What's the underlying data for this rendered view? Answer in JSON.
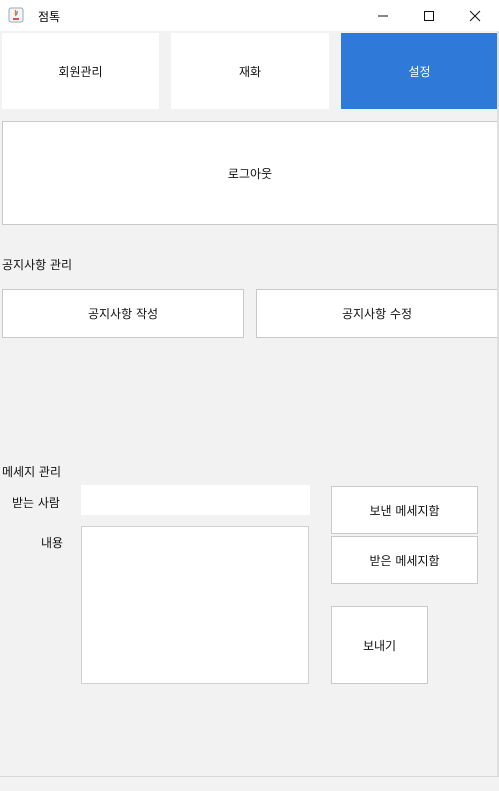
{
  "window": {
    "title": "점톡"
  },
  "tabs": [
    {
      "label": "회원관리",
      "active": false
    },
    {
      "label": "재화",
      "active": false
    },
    {
      "label": "설정",
      "active": true
    }
  ],
  "logout_label": "로그아웃",
  "notice": {
    "section_label": "공지사항 관리",
    "write_label": "공지사항 작성",
    "edit_label": "공지사항 수정"
  },
  "message": {
    "section_label": "메세지 관리",
    "recipient_label": "받는 사람",
    "recipient_value": "",
    "content_label": "내용",
    "content_value": "",
    "sent_box_label": "보낸 메세지함",
    "inbox_label": "받은 메세지함",
    "send_label": "보내기"
  },
  "colors": {
    "accent": "#2f7ad9",
    "background": "#f2f2f2"
  }
}
